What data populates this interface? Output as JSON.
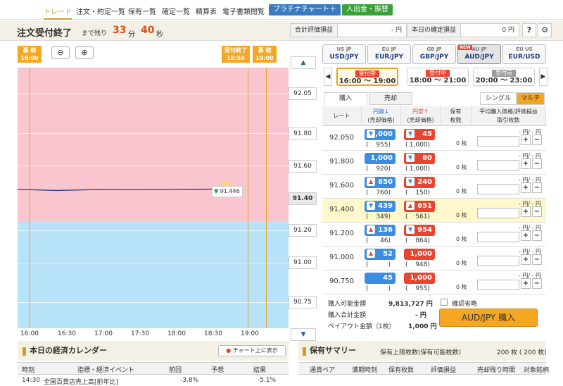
{
  "nav": {
    "items": [
      "トレード",
      "注文・約定一覧",
      "保有一覧",
      "確定一覧",
      "精算表",
      "電子書類閲覧"
    ],
    "platinum_btn": "プラチナチャート＋",
    "deposit_btn": "入出金・振替"
  },
  "header": {
    "title": "注文受付終了",
    "sub": "まで残り",
    "minutes": "33",
    "min_unit": "分",
    "seconds": "40",
    "sec_unit": "秒",
    "pl_label": "合計評価損益",
    "pl_value": "- 円",
    "today_label": "本日の確定損益",
    "today_value": "0 円",
    "help": "?",
    "settings_icon": "gear-icon"
  },
  "chart": {
    "flags": [
      {
        "l1": "募 続",
        "l2": "16:00"
      },
      {
        "l1": "受付終了",
        "l2": "18:58"
      },
      {
        "l1": "募 続",
        "l2": "19:00"
      }
    ],
    "price_labels": [
      "92.05",
      "91.80",
      "91.60",
      "91.40",
      "91.20",
      "91.00",
      "90.75"
    ],
    "current": "91.446",
    "x_ticks": [
      "16:00",
      "16:30",
      "17:00",
      "17:30",
      "18:00",
      "18:30",
      "19:00"
    ]
  },
  "chart_data": {
    "type": "line",
    "x": [
      "16:00",
      "16:30",
      "17:00",
      "17:30",
      "18:00",
      "18:30",
      "18:39"
    ],
    "values": [
      91.446,
      91.44,
      91.445,
      91.444,
      91.446,
      91.447,
      91.446
    ],
    "ylim": [
      90.7,
      92.1
    ],
    "title": "",
    "xlabel": "",
    "ylabel": ""
  },
  "pairs": [
    {
      "name": "USD/JPY",
      "flags": "US JP"
    },
    {
      "name": "EUR/JPY",
      "flags": "EU JP"
    },
    {
      "name": "GBP/JPY",
      "flags": "GB JP"
    },
    {
      "name": "AUD/JPY",
      "flags": "AU JP",
      "badge": "NEW"
    },
    {
      "name": "EUR/USD",
      "flags": "EU US"
    }
  ],
  "sessions": [
    {
      "tag": "受付中",
      "time": "16:00 〜 19:00",
      "color": "#e84530"
    },
    {
      "tag": "受付中",
      "time": "18:00 〜 21:00",
      "color": "#e84530"
    },
    {
      "tag": "受付前",
      "time": "20:00 〜 23:00",
      "color": "#999999"
    }
  ],
  "tabs": {
    "buy": "購入",
    "sell": "売却",
    "single": "シングル",
    "multi": "マルチ"
  },
  "table": {
    "headers": {
      "rate": "レート",
      "yendaka": "円高↓",
      "yendaka_sub": "(売却価格)",
      "yenyasu": "円安↑",
      "yenyasu_sub": "(売却価格)",
      "pos": "保有",
      "pos_sub": "枚数",
      "avg": "平均購入価格/評価損益",
      "avg_sub": "取引枚数"
    },
    "rows": [
      {
        "rate": "92.050",
        "b": "1,000",
        "bc": "955",
        "r": "45",
        "rc": "1,000",
        "pos": "0 枚",
        "bdir": "down",
        "rdir": "down"
      },
      {
        "rate": "91.800",
        "b": "1,000",
        "bc": "920",
        "r": "80",
        "rc": "1,000",
        "pos": "0 枚",
        "bdir": "none",
        "rdir": "down"
      },
      {
        "rate": "91.600",
        "b": "850",
        "bc": "760",
        "r": "240",
        "rc": "150",
        "pos": "0 枚",
        "bdir": "up",
        "rdir": "down"
      },
      {
        "rate": "91.400",
        "b": "439",
        "bc": "349",
        "r": "651",
        "rc": "561",
        "pos": "0 枚",
        "bdir": "down",
        "rdir": "up"
      },
      {
        "rate": "91.200",
        "b": "136",
        "bc": "46",
        "r": "954",
        "rc": "864",
        "pos": "0 枚",
        "bdir": "up",
        "rdir": "down"
      },
      {
        "rate": "91.000",
        "b": "52",
        "bc": "",
        "r": "1,000",
        "rc": "948",
        "pos": "0 枚",
        "bdir": "up",
        "rdir": "none"
      },
      {
        "rate": "90.750",
        "b": "45",
        "bc": "",
        "r": "1,000",
        "rc": "955",
        "pos": "0 枚",
        "bdir": "none",
        "rdir": "none"
      }
    ],
    "avg_line": "- 円/ - 円"
  },
  "summary": {
    "avail_label": "購入可能金額",
    "avail": "9,813,727 円",
    "total_label": "購入合計金額",
    "total": "- 円",
    "payout_label": "ペイアウト金額（1枚）",
    "payout": "1,000 円",
    "confirm": "確認省略",
    "buy_btn": "AUD/JPY 購入"
  },
  "calendar": {
    "title": "本日の経済カレンダー",
    "chart_btn": "チャート上に表示",
    "cols": [
      "時刻",
      "指標・経済イベント",
      "前回",
      "予想",
      "結果"
    ],
    "row": [
      "14:30",
      "全国百貨店売上高[前年比]",
      "-3.8%",
      "",
      "-5.1%"
    ]
  },
  "holdings": {
    "title": "保有サマリー",
    "limit_label": "保有上限枚数(保有可能枚数)",
    "limit": "200 枚 ( 200 枚)",
    "cols": [
      "通貨ペア",
      "満期時刻",
      "保有枚数",
      "評価損益",
      "売却残り時間",
      "対象銘柄"
    ]
  }
}
